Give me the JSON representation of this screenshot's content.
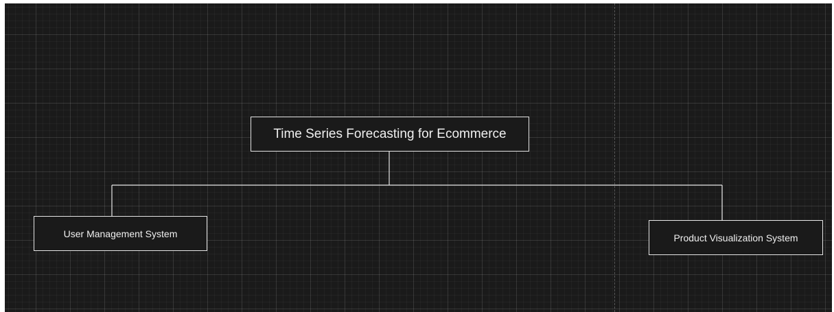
{
  "diagram": {
    "root": {
      "label": "Time Series Forecasting for Ecommerce"
    },
    "children": [
      {
        "label": "User Management System"
      },
      {
        "label": "Product Visualization System"
      }
    ]
  },
  "colors": {
    "canvas_background": "#1a1a1a",
    "node_border": "#e6e6e6",
    "text": "#f0f0f0",
    "connector": "#e6e6e6"
  }
}
